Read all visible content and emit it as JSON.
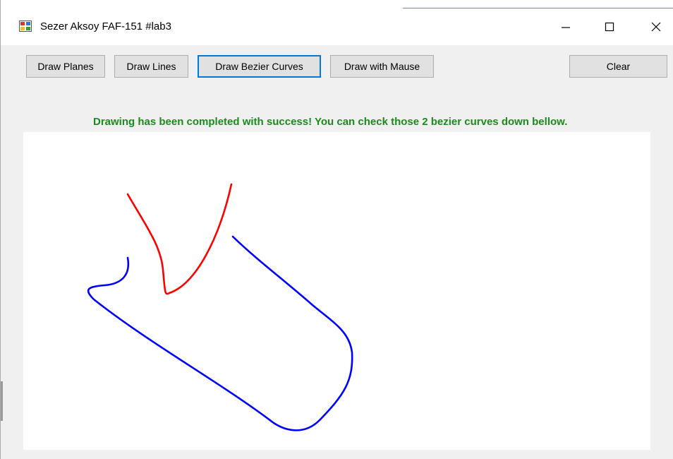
{
  "window": {
    "title": "Sezer Aksoy FAF-151 #lab3"
  },
  "toolbar": {
    "draw_planes_label": "Draw Planes",
    "draw_lines_label": "Draw Lines",
    "draw_bezier_label": "Draw Bezier Curves",
    "draw_mouse_label": "Draw with Mause",
    "clear_label": "Clear"
  },
  "status": {
    "message": "Drawing has been completed with success! You can check those 2 bezier curves down bellow.",
    "color": "#1b8b1b"
  },
  "canvas": {
    "curves": [
      {
        "name": "red-curve",
        "color": "#ff0000"
      },
      {
        "name": "blue-curve",
        "color": "#0000ff"
      }
    ]
  },
  "colors": {
    "focus_accent": "#0078d7",
    "window_background": "#f0f0f0",
    "button_face": "#e1e1e1"
  }
}
